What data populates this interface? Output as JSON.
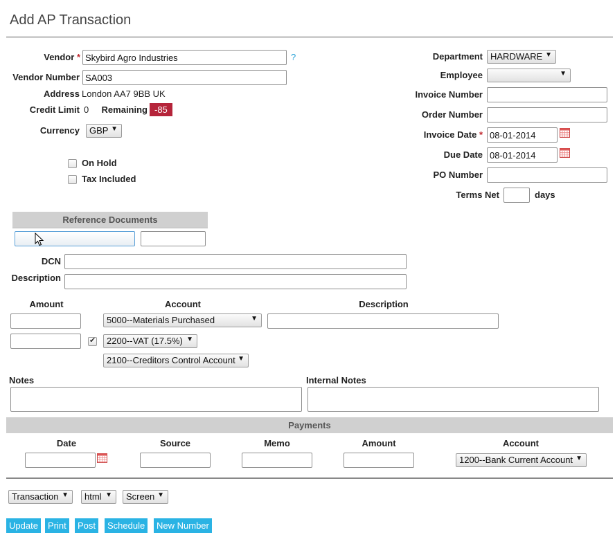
{
  "page": {
    "title": "Add AP Transaction"
  },
  "vendor": {
    "vendor_label": "Vendor",
    "vendor_value": "Skybird Agro Industries",
    "help": "?",
    "vendor_number_label": "Vendor Number",
    "vendor_number_value": "SA003",
    "address_label": "Address",
    "address_value": "London AA7 9BB UK",
    "credit_limit_label": "Credit Limit",
    "credit_limit_value": "0",
    "remaining_label": "Remaining",
    "remaining_value": "-85",
    "currency_label": "Currency",
    "currency_value": "GBP",
    "on_hold_label": "On Hold",
    "tax_included_label": "Tax Included"
  },
  "header_right": {
    "department_label": "Department",
    "department_value": "HARDWARE",
    "employee_label": "Employee",
    "employee_value": "",
    "invoice_number_label": "Invoice Number",
    "order_number_label": "Order Number",
    "invoice_date_label": "Invoice Date",
    "invoice_date_value": "08-01-2014",
    "due_date_label": "Due Date",
    "due_date_value": "08-01-2014",
    "po_number_label": "PO Number",
    "terms_label": "Terms Net",
    "terms_unit": "days"
  },
  "reference": {
    "title": "Reference Documents",
    "dcn_label": "DCN",
    "description_label": "Description"
  },
  "lines": {
    "amount_header": "Amount",
    "account_header": "Account",
    "description_header": "Description",
    "account_1": "5000--Materials Purchased",
    "tax_account": "2200--VAT (17.5%)",
    "ap_account": "2100--Creditors Control Account"
  },
  "notes": {
    "notes_label": "Notes",
    "internal_notes_label": "Internal Notes"
  },
  "payments": {
    "title": "Payments",
    "date_header": "Date",
    "source_header": "Source",
    "memo_header": "Memo",
    "amount_header": "Amount",
    "account_header": "Account",
    "account_value": "1200--Bank Current Account"
  },
  "output": {
    "format_1": "Transaction",
    "format_2": "html",
    "format_3": "Screen"
  },
  "buttons": {
    "update": "Update",
    "print": "Print",
    "post": "Post",
    "schedule": "Schedule",
    "new_number": "New Number"
  },
  "colors": {
    "accent_button": "#2ab3e4",
    "remaining_badge": "#b5243a",
    "required_star": "#c0262d",
    "help_link": "#2aa3d8",
    "section_bar": "#d0d0d0"
  }
}
